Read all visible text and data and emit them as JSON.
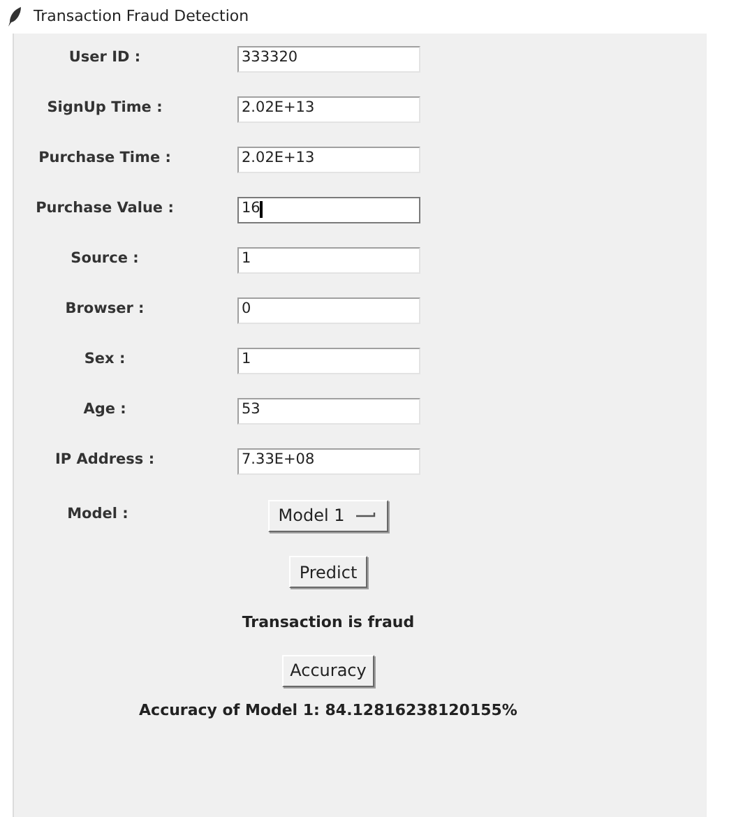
{
  "window": {
    "title": "Transaction Fraud Detection"
  },
  "fields": [
    {
      "label": "User ID :",
      "value": "333320",
      "focused": false
    },
    {
      "label": "SignUp Time :",
      "value": "2.02E+13",
      "focused": false
    },
    {
      "label": "Purchase Time :",
      "value": "2.02E+13",
      "focused": false
    },
    {
      "label": "Purchase Value :",
      "value": "16",
      "focused": true
    },
    {
      "label": "Source :",
      "value": "1",
      "focused": false
    },
    {
      "label": "Browser :",
      "value": "0",
      "focused": false
    },
    {
      "label": "Sex :",
      "value": "1",
      "focused": false
    },
    {
      "label": "Age :",
      "value": "53",
      "focused": false
    },
    {
      "label": "IP Address :",
      "value": "7.33E+08",
      "focused": false
    }
  ],
  "model": {
    "label": "Model :",
    "value": "Model 1"
  },
  "predict_button": "Predict",
  "result": "Transaction is fraud",
  "accuracy_button": "Accuracy",
  "accuracy_text": "Accuracy of Model 1: 84.12816238120155%"
}
